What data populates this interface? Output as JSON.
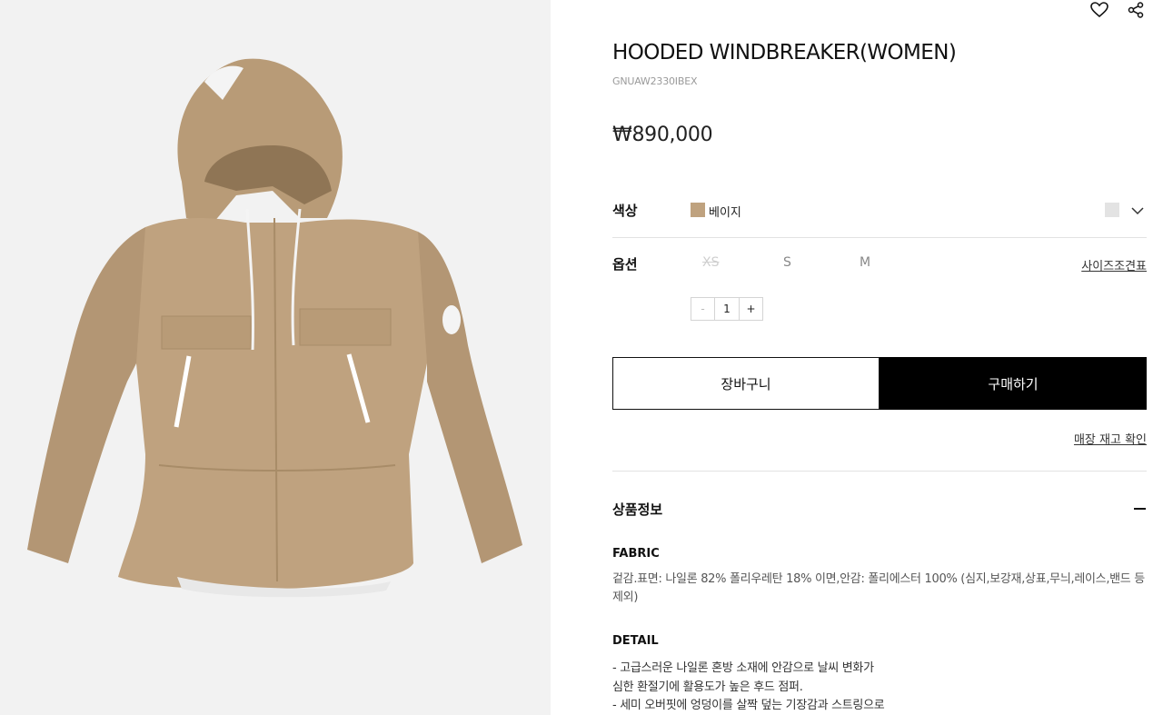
{
  "product": {
    "title": "HOODED WINDBREAKER(WOMEN)",
    "sku": "GNUAW2330IBEX",
    "price": "₩890,000",
    "image_icon": "jacket-illustration"
  },
  "options": {
    "color_label": "색상",
    "color_value": "베이지",
    "color_swatch": "#bfa27f",
    "size_label": "옵션",
    "sizes": [
      {
        "label": "XS",
        "available": false
      },
      {
        "label": "S",
        "available": true
      },
      {
        "label": "M",
        "available": true
      }
    ],
    "size_guide": "사이즈조견표",
    "quantity": {
      "minus": "-",
      "value": "1",
      "plus": "+"
    }
  },
  "actions": {
    "cart": "장바구니",
    "buy": "구매하기",
    "stock_check": "매장 재고 확인"
  },
  "info": {
    "section_title": "상품정보",
    "fabric_label": "FABRIC",
    "fabric_text": "겉감.표면: 나일론 82% 폴리우레탄 18% 이면,안감: 폴리에스터 100% (심지,보강재,상표,무늬,레이스,밴드 등 제외)",
    "detail_label": "DETAIL",
    "detail_lines": [
      "- 고급스러운 나일론 혼방 소재에 안감으로 날씨 변화가",
      "  심한 환절기에 활용도가 높은 후드 점퍼.",
      "- 세미 오버핏에 엉덩이를 살짝 덮는 기장감과 스트링으로"
    ]
  },
  "colors": {
    "primary": "#000000",
    "jacket": "#bfa27f",
    "gallery_bg": "#f2f2f2"
  }
}
